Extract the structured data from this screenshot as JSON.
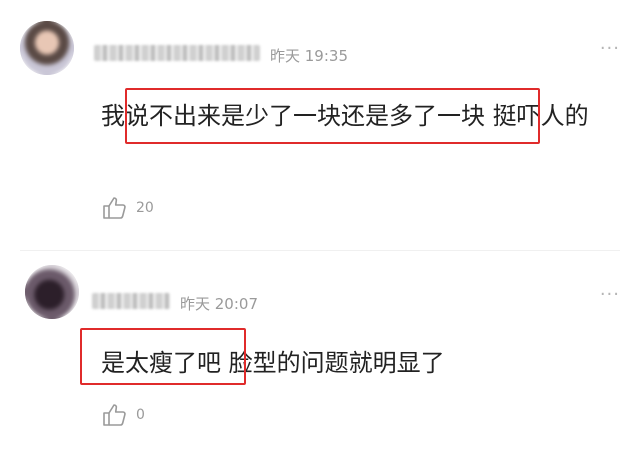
{
  "comments": [
    {
      "time": "昨天 19:35",
      "text": "我说不出来是少了一块还是多了一块 挺吓人的",
      "likes": "20"
    },
    {
      "time": "昨天 20:07",
      "text": "是太瘦了吧 脸型的问题就明显了",
      "likes": "0"
    }
  ],
  "icons": {
    "like": "thumbs-up-icon",
    "more": "more-dots-icon"
  },
  "colors": {
    "highlight": "#e02b2b",
    "meta_text": "#9a9a9a",
    "body_text": "#222222"
  },
  "more_glyph": "···"
}
